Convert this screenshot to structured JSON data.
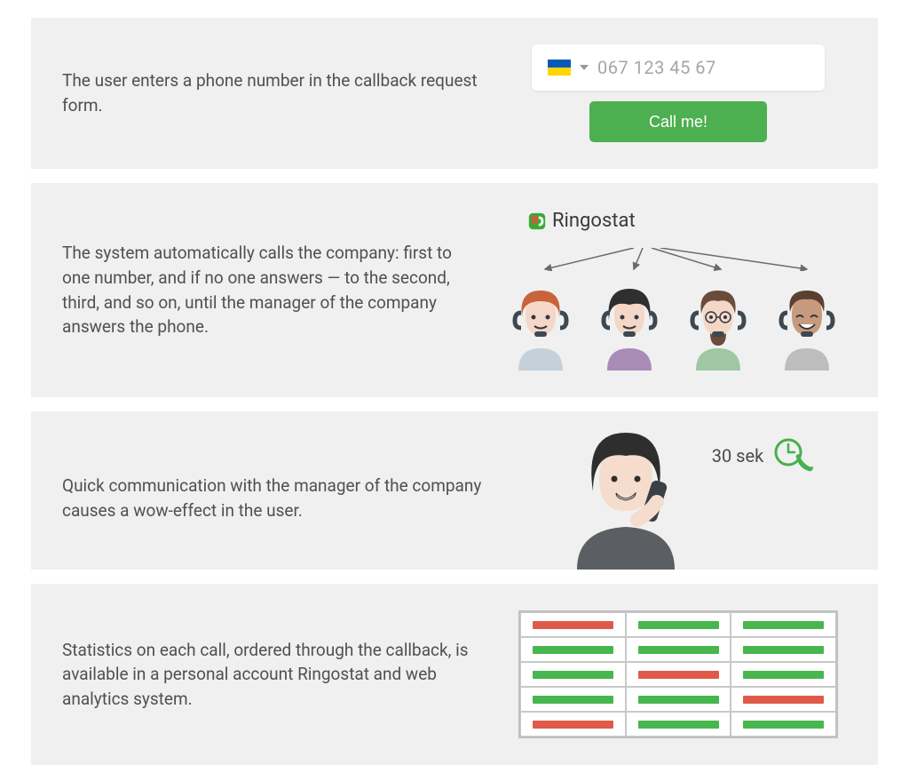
{
  "steps": [
    {
      "text": "The user enters a phone number in the callback request form.",
      "phone_placeholder": "067 123 45 67",
      "button_label": "Call me!",
      "country_flag": "ukraine"
    },
    {
      "text": "The system automatically calls the company: first to one number, and if no one answers — to the second, third, and so on, until the manager of the company answers the phone.",
      "brand": "Ringostat",
      "agents": [
        "agent-1",
        "agent-2",
        "agent-3",
        "agent-4"
      ]
    },
    {
      "text": "Quick communication with the manager of the company causes a wow-effect in the user.",
      "badge_text": "30 sek"
    },
    {
      "text": "Statistics on each call, ordered through the callback, is available in a personal account Ringostat and web analytics system.",
      "grid": [
        [
          "red",
          "green",
          "green"
        ],
        [
          "green",
          "green",
          "green"
        ],
        [
          "green",
          "red",
          "green"
        ],
        [
          "green",
          "green",
          "red"
        ],
        [
          "red",
          "green",
          "green"
        ]
      ]
    }
  ],
  "colors": {
    "accent_green": "#4caf50",
    "bar_red": "#e05a4a",
    "bar_green": "#48b64e",
    "bg": "#f0f0f0"
  }
}
